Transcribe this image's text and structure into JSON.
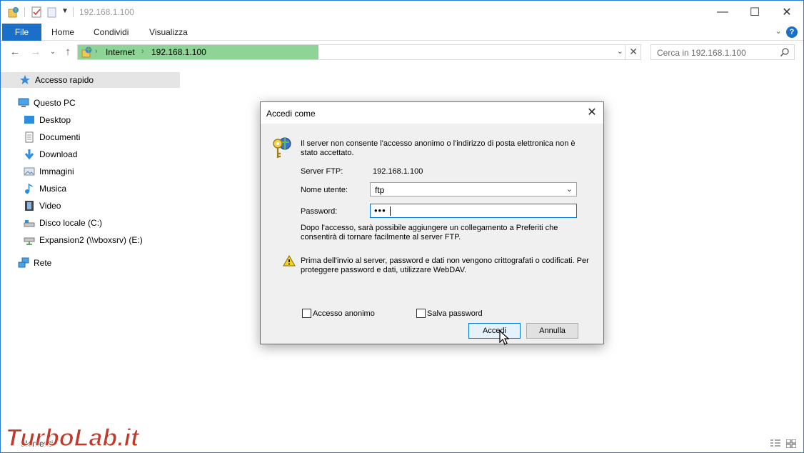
{
  "titlebar": {
    "title": "192.168.1.100",
    "icons": [
      "ftp-folder-icon",
      "properties-check-icon",
      "new-folder-icon",
      "customize-dropdown-icon"
    ],
    "controls": [
      "minimize-icon",
      "maximize-icon",
      "close-icon"
    ]
  },
  "ribbon": {
    "tabs": [
      "File",
      "Home",
      "Condividi",
      "Visualizza"
    ],
    "help": "?"
  },
  "address": {
    "crumbs": [
      "Internet",
      "192.168.1.100"
    ],
    "search_placeholder": "Cerca in 192.168.1.100"
  },
  "nav": {
    "quick_access": "Accesso rapido",
    "this_pc": "Questo PC",
    "items": [
      "Desktop",
      "Documenti",
      "Download",
      "Immagini",
      "Musica",
      "Video",
      "Disco locale (C:)",
      "Expansion2 (\\\\vboxsrv) (E:)"
    ],
    "network": "Rete"
  },
  "dialog": {
    "title": "Accedi come",
    "message": "Il server non consente l'accesso anonimo o l'indirizzo di posta elettronica non è stato accettato.",
    "server_label": "Server FTP:",
    "server_value": "192.168.1.100",
    "username_label": "Nome utente:",
    "username_value": "ftp",
    "password_label": "Password:",
    "password_value": "•••",
    "info": "Dopo l'accesso, sarà possibile aggiungere un collegamento a Preferiti che consentirà di tornare facilmente al server FTP.",
    "warning": "Prima dell'invio al server, password e dati non vengono crittografati o codificati. Per proteggere password e dati, utilizzare WebDAV.",
    "anonymous_label": "Accesso anonimo",
    "anonymous_checked": false,
    "save_password_label": "Salva password",
    "save_password_checked": false,
    "login_button": "Accedi",
    "cancel_button": "Annulla"
  },
  "statusbar": {
    "partial_text": "elementi"
  },
  "watermark": {
    "text": "TurboLab.it"
  },
  "colors": {
    "accent": "#1a6fc9",
    "address_fill": "#8ed497",
    "selection": "#e5e5e5"
  }
}
